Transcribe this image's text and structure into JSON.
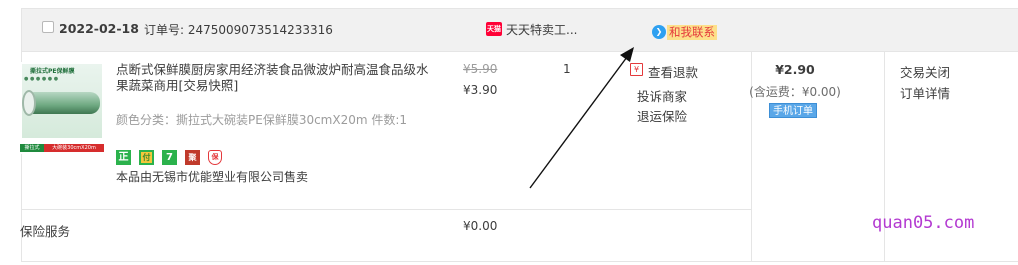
{
  "order": {
    "date": "2022-02-18",
    "order_number": "订单号: 2475009073514233316",
    "shop_icon_label": "天猫",
    "shop_name": "天天特卖工...",
    "contact_label": "和我联系"
  },
  "item": {
    "title": "点断式保鲜膜厨房家用经济装食品微波炉耐高温食品级水果蔬菜商用",
    "snapshot": "[交易快照]",
    "spec": "颜色分类：撕拉式大碗装PE保鲜膜30cmX20m  件数:1",
    "seller": "本品由无锡市优能塑业有限公司售卖",
    "original_price": "¥5.90",
    "price": "¥3.90",
    "quantity": "1",
    "thumbnail": {
      "brand_text": "撕拉式PE保鲜膜",
      "tag_left": "撕拉式",
      "tag_right": "大碗装30cmX20m"
    },
    "badges": {
      "zheng": "正",
      "pay": "付",
      "seven": "7",
      "ju": "聚",
      "shield": "保"
    }
  },
  "actions": {
    "refund_icon": "¥",
    "refund": "查看退款",
    "complain": "投诉商家",
    "return_insurance": "退运保险"
  },
  "payment": {
    "total": "¥2.90",
    "freight": "(含运费：¥0.00)",
    "mobile_order": "手机订单"
  },
  "status": {
    "state": "交易关闭",
    "detail": "订单详情"
  },
  "insurance": {
    "label": "保险服务",
    "price": "¥0.00"
  },
  "watermark": "quan05.com",
  "colors": {
    "header_bg": "#f1f1f1",
    "border": "#e5e5e5",
    "tmall_red": "#ff0036",
    "contact_bg": "#fde08a",
    "mobile_badge": "#5aa7e8",
    "watermark": "#b33ad1"
  }
}
